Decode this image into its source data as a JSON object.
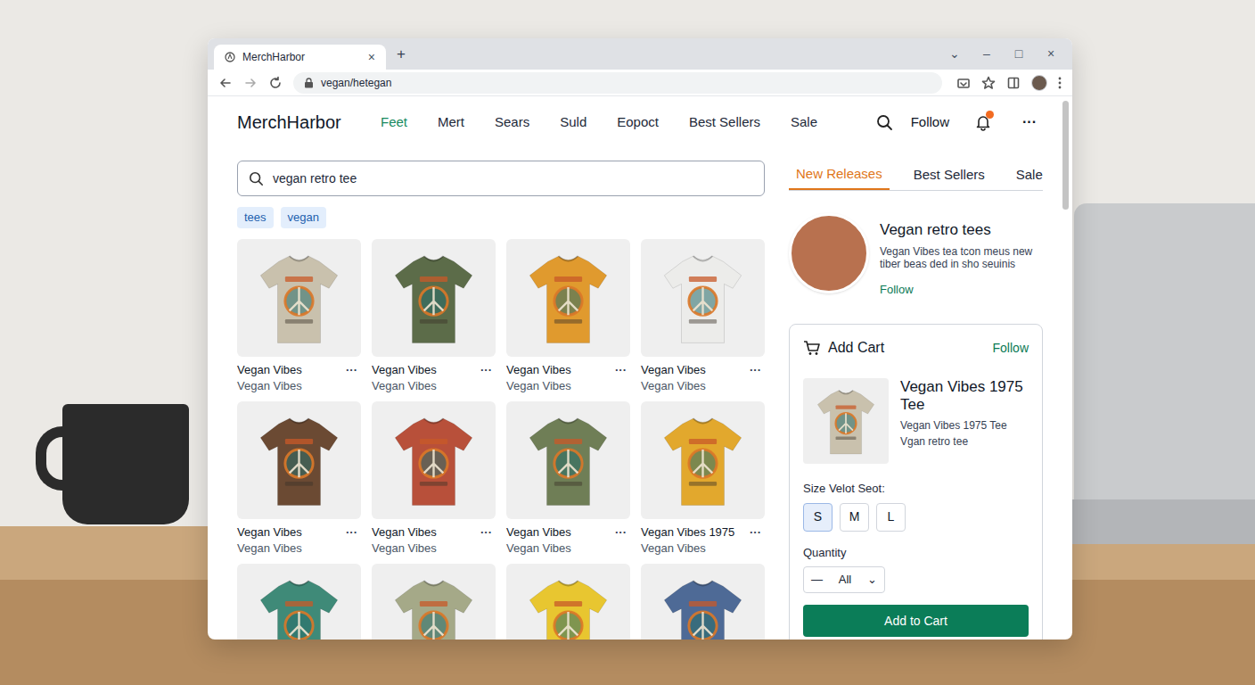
{
  "browser": {
    "tab": {
      "title": "MerchHarbor",
      "close": "×"
    },
    "new_tab": "+",
    "address": "vegan/hetegan",
    "controls": [
      "⌄",
      "–",
      "□",
      "×"
    ]
  },
  "header": {
    "logo": "MerchHarbor",
    "nav": [
      {
        "label": "Feet",
        "selected": true
      },
      {
        "label": "Mert",
        "selected": false
      },
      {
        "label": "Sears",
        "selected": false
      },
      {
        "label": "Suld",
        "selected": false
      },
      {
        "label": "Eopoct",
        "selected": false
      },
      {
        "label": "Best Sellers",
        "selected": false
      },
      {
        "label": "Sale",
        "selected": false
      }
    ],
    "follow": "Follow",
    "notifications_unread": true,
    "more": "···"
  },
  "search": {
    "value": "vegan retro tee"
  },
  "chips": [
    "tees",
    "vegan"
  ],
  "products": [
    {
      "title": "Vegan Vibes",
      "subtitle": "Vegan Vibes",
      "menu": "···",
      "color": "#c9c1ad"
    },
    {
      "title": "Vegan Vibes",
      "subtitle": "Vegan Vibes",
      "menu": "···",
      "color": "#5c6c49"
    },
    {
      "title": "Vegan Vibes",
      "subtitle": "Vegan Vibes",
      "menu": "···",
      "color": "#e09a2e"
    },
    {
      "title": "Vegan Vibes",
      "subtitle": "Vegan Vibes",
      "menu": "···",
      "color": "#ececea"
    },
    {
      "title": "Vegan Vibes",
      "subtitle": "Vegan Vibes",
      "menu": "···",
      "color": "#6b4a33"
    },
    {
      "title": "Vegan Vibes",
      "subtitle": "Vegan Vibes",
      "menu": "···",
      "color": "#b8503a"
    },
    {
      "title": "Vegan Vibes",
      "subtitle": "Vegan Vibes",
      "menu": "···",
      "color": "#6f7e56"
    },
    {
      "title": "Vegan Vibes 1975",
      "subtitle": "Vegan Vibes",
      "menu": "···",
      "color": "#e2a82d"
    }
  ],
  "more_products": [
    {
      "color": "#3f8a78"
    },
    {
      "color": "#a5a988"
    },
    {
      "color": "#e8c630"
    },
    {
      "color": "#4e6a96"
    }
  ],
  "sidebar": {
    "tabs": [
      {
        "label": "New Releases",
        "selected": true
      },
      {
        "label": "Best Sellers",
        "selected": false
      },
      {
        "label": "Sale",
        "selected": false
      }
    ],
    "profile": {
      "name": "Vegan retro tees",
      "bio": [
        "Vegan Vibes tea tcon meus new",
        "tiber beas ded in sho seuinis"
      ],
      "follow": "Follow"
    },
    "cart": {
      "heading": "Add Cart",
      "follow": "Follow",
      "item": {
        "title": "Vegan Vibes 1975 Tee",
        "subtitle": "Vegan Vibes 1975 Tee",
        "note": "Vgan retro tee",
        "color": "#c9c1ad"
      },
      "size_label": "Size Velot Seot:",
      "sizes": [
        {
          "label": "S",
          "selected": true
        },
        {
          "label": "M",
          "selected": false
        },
        {
          "label": "L",
          "selected": false
        }
      ],
      "quantity_label": "Quantity",
      "quantity": {
        "decrement": "—",
        "value": "All",
        "toggle": "⌄"
      },
      "button": "Add to Cart"
    }
  }
}
